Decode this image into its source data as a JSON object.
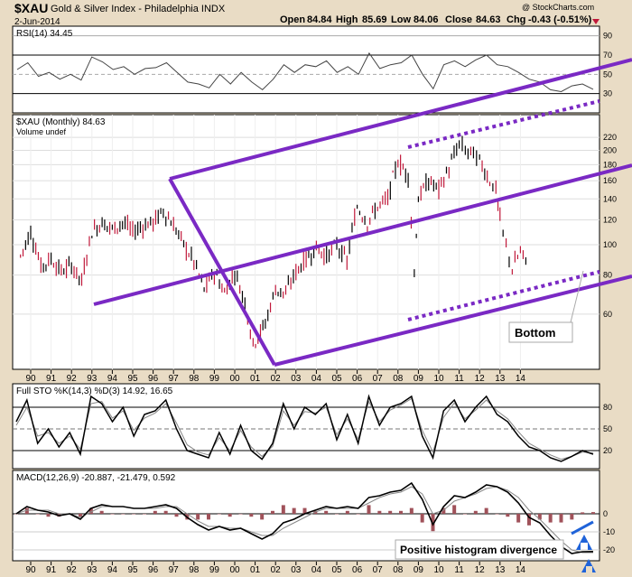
{
  "header": {
    "symbol": "$XAU",
    "name": "Gold & Silver Index - Philadelphia  INDX",
    "date": "2-Jun-2014",
    "watermark": "@ StockCharts.com",
    "open_label": "Open",
    "open": "84.84",
    "high_label": "High",
    "high": "85.69",
    "low_label": "Low",
    "low": "84.06",
    "close_label": "Close",
    "close": "84.63",
    "chg_label": "Chg",
    "chg": "-0.43 (-0.51%)"
  },
  "panels": {
    "rsi_title": "RSI(14) 34.45",
    "price_title": "$XAU (Monthly) 84.63",
    "volume_label": "Volume undef",
    "sto_title": "Full STO %K(14,3) %D(3) 14.92, 16.65",
    "macd_title": "MACD(12,26,9) -20.887, -21.479, 0.592"
  },
  "annotations": {
    "bottom": "Bottom",
    "divergence": "Positive histogram divergence"
  },
  "colors": {
    "background": "#e9dcc5",
    "panel": "#ffffff",
    "channel": "#7a29c4",
    "annotation_text": "#1c2fa8",
    "arrow": "#1f63d9",
    "price_up": "#000000",
    "price_down": "#c0183a",
    "histogram": "#a0525a"
  },
  "chart_data": {
    "type": "line",
    "title": "$XAU Gold & Silver Index - Philadelphia (Monthly)",
    "x_ticks": [
      "90",
      "91",
      "92",
      "93",
      "94",
      "95",
      "96",
      "97",
      "98",
      "99",
      "00",
      "01",
      "02",
      "03",
      "04",
      "05",
      "06",
      "07",
      "08",
      "09",
      "10",
      "11",
      "12",
      "13",
      "14"
    ],
    "price": {
      "scale": "log",
      "y_ticks": [
        60,
        80,
        100,
        120,
        140,
        160,
        180,
        200,
        220
      ],
      "x": [
        1989.5,
        1990,
        1990.5,
        1991,
        1991.5,
        1992,
        1992.5,
        1993,
        1993.5,
        1994,
        1994.5,
        1995,
        1995.5,
        1996,
        1996.5,
        1997,
        1997.5,
        1998,
        1998.5,
        1999,
        1999.5,
        2000,
        2000.5,
        2000.9,
        2001.5,
        2002,
        2002.5,
        2003,
        2003.5,
        2004,
        2004.5,
        2005,
        2005.5,
        2006,
        2006.5,
        2007,
        2007.5,
        2008,
        2008.5,
        2008.8,
        2009,
        2009.5,
        2010,
        2010.5,
        2011,
        2011.3,
        2011.7,
        2012,
        2012.5,
        2012.8,
        2013,
        2013.3,
        2013.6,
        2014,
        2014.4
      ],
      "close": [
        92,
        110,
        85,
        90,
        82,
        86,
        76,
        110,
        118,
        112,
        118,
        110,
        115,
        118,
        128,
        115,
        100,
        88,
        72,
        82,
        70,
        82,
        65,
        48,
        56,
        72,
        70,
        82,
        90,
        98,
        92,
        100,
        88,
        132,
        118,
        132,
        140,
        185,
        165,
        80,
        140,
        160,
        150,
        175,
        210,
        200,
        195,
        185,
        160,
        150,
        120,
        98,
        84,
        95,
        84.63
      ]
    },
    "rsi": {
      "y_ticks": [
        30,
        50,
        70,
        90
      ],
      "latest": 34.45,
      "values": [
        55,
        62,
        48,
        52,
        45,
        50,
        44,
        68,
        63,
        55,
        58,
        50,
        56,
        57,
        62,
        52,
        42,
        40,
        36,
        50,
        40,
        52,
        42,
        34,
        45,
        60,
        52,
        60,
        58,
        64,
        52,
        58,
        50,
        72,
        56,
        60,
        62,
        70,
        50,
        35,
        60,
        64,
        58,
        65,
        70,
        60,
        58,
        52,
        45,
        42,
        34,
        32,
        38,
        40,
        34.45
      ]
    },
    "stochastic": {
      "y_ticks": [
        20,
        50,
        80
      ],
      "k_latest": 14.92,
      "d_latest": 16.65,
      "k": [
        60,
        90,
        30,
        50,
        25,
        45,
        15,
        95,
        85,
        60,
        80,
        40,
        70,
        75,
        90,
        50,
        20,
        15,
        10,
        45,
        15,
        55,
        20,
        8,
        30,
        85,
        50,
        80,
        70,
        85,
        35,
        70,
        30,
        95,
        55,
        80,
        85,
        95,
        40,
        10,
        75,
        90,
        60,
        80,
        95,
        70,
        60,
        40,
        25,
        20,
        10,
        5,
        12,
        20,
        14.92
      ],
      "d": [
        55,
        80,
        40,
        45,
        30,
        40,
        22,
        85,
        88,
        65,
        75,
        48,
        65,
        72,
        85,
        58,
        28,
        18,
        14,
        38,
        20,
        48,
        25,
        12,
        26,
        75,
        55,
        74,
        72,
        80,
        42,
        64,
        36,
        88,
        60,
        76,
        83,
        92,
        48,
        18,
        66,
        86,
        64,
        76,
        90,
        75,
        64,
        46,
        30,
        22,
        14,
        8,
        12,
        18,
        16.65
      ]
    },
    "macd": {
      "y_ticks": [
        -20,
        -10,
        0
      ],
      "macd_latest": -20.887,
      "signal_latest": -21.479,
      "histogram_latest": 0.592,
      "macd": [
        0,
        4,
        2,
        1,
        -1,
        0,
        -3,
        3,
        5,
        4,
        4,
        3,
        3,
        4,
        5,
        3,
        -2,
        -6,
        -9,
        -7,
        -9,
        -8,
        -11,
        -14,
        -11,
        -5,
        -3,
        0,
        2,
        4,
        3,
        4,
        3,
        9,
        10,
        12,
        13,
        17,
        8,
        -6,
        4,
        10,
        9,
        12,
        16,
        15,
        12,
        6,
        -2,
        -5,
        -12,
        -18,
        -22,
        -21,
        -20.887
      ],
      "signal": [
        0,
        2,
        2,
        2,
        0,
        0,
        -2,
        1,
        4,
        4,
        4,
        3,
        3,
        3,
        4,
        4,
        0,
        -4,
        -7,
        -7,
        -8,
        -8,
        -10,
        -12,
        -12,
        -8,
        -5,
        -2,
        1,
        3,
        3,
        3,
        3,
        6,
        9,
        11,
        12,
        15,
        11,
        0,
        2,
        7,
        9,
        11,
        14,
        15,
        13,
        9,
        2,
        -3,
        -9,
        -15,
        -20,
        -21.5,
        -21.479
      ]
    }
  }
}
